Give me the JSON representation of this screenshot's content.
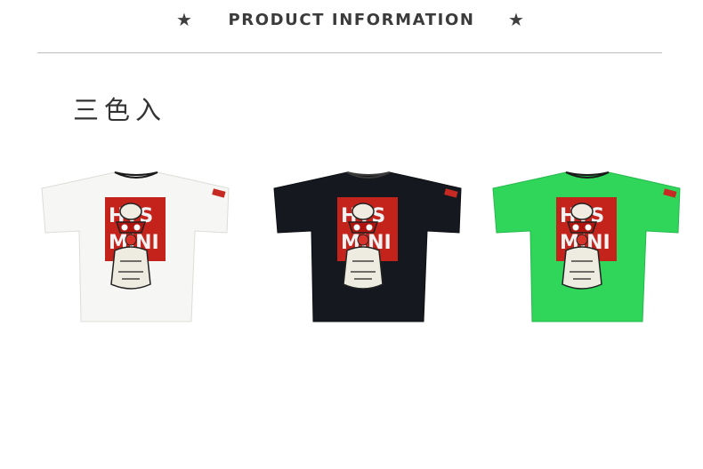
{
  "header": {
    "title": "PRODUCT INFORMATION",
    "star_left_icon": "star-icon",
    "star_right_icon": "star-icon",
    "star_glyph": "★"
  },
  "subtitle": "三色入",
  "products": [
    {
      "name": "white-tshirt",
      "color": "#f6f6f4",
      "collar": "#e6e6e2",
      "tag": "#c72a22"
    },
    {
      "name": "black-tshirt",
      "color": "#15191f",
      "collar": "#0e1115",
      "tag": "#c72a22"
    },
    {
      "name": "green-tshirt",
      "color": "#2fd65a",
      "collar": "#22b64a",
      "tag": "#c72a22"
    }
  ],
  "print": {
    "panel_color": "#c4231c",
    "text_line1": "HYS",
    "text_line2": "MINI"
  }
}
